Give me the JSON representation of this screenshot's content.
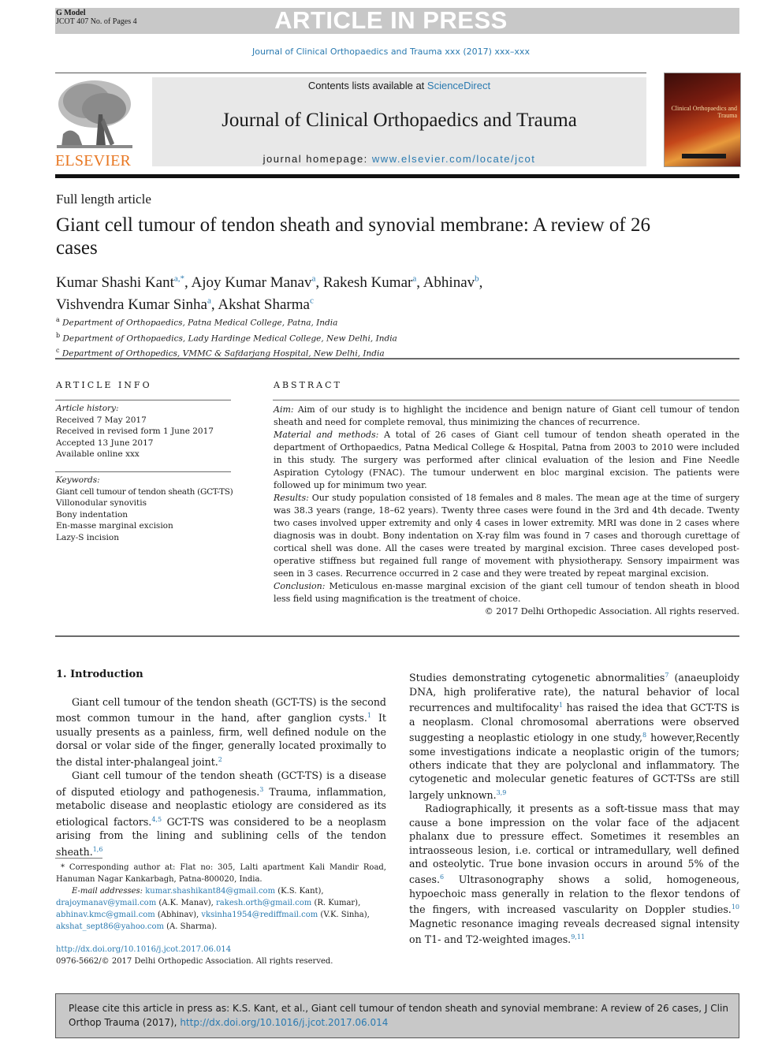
{
  "banner": {
    "g_model": "G Model",
    "jcot_line": "JCOT 407 No. of Pages 4",
    "status": "ARTICLE IN PRESS",
    "journal_ref": "Journal of Clinical Orthopaedics and Trauma xxx (2017) xxx–xxx"
  },
  "header": {
    "publisher": "ELSEVIER",
    "contents_prefix": "Contents lists available at ",
    "contents_link": "ScienceDirect",
    "journal_title": "Journal of Clinical Orthopaedics and Trauma",
    "homepage_prefix": "journal homepage: ",
    "homepage_link": "www.elsevier.com/locate/jcot",
    "cover_title": "Clinical Orthopaedics and Trauma"
  },
  "article": {
    "type": "Full length article",
    "title": "Giant cell tumour of tendon sheath and synovial membrane: A review of 26 cases",
    "authors": [
      {
        "name": "Kumar Shashi Kant",
        "aff": "a,*",
        "sep": ", "
      },
      {
        "name": "Ajoy Kumar Manav",
        "aff": "a",
        "sep": ", "
      },
      {
        "name": "Rakesh Kumar",
        "aff": "a",
        "sep": ", "
      },
      {
        "name": "Abhinav",
        "aff": "b",
        "sep": ","
      },
      {
        "name": "Vishvendra Kumar Sinha",
        "aff": "a",
        "sep": ", "
      },
      {
        "name": "Akshat Sharma",
        "aff": "c",
        "sep": ""
      }
    ],
    "affiliations": [
      {
        "letter": "a",
        "text": "Department of Orthopaedics, Patna Medical College, Patna, India"
      },
      {
        "letter": "b",
        "text": "Department of Orthopaedics, Lady Hardinge Medical College, New Delhi, India"
      },
      {
        "letter": "c",
        "text": "Department of Orthopedics, VMMC & Safdarjang Hospital, New Delhi, India"
      }
    ]
  },
  "article_info": {
    "heading": "ARTICLE INFO",
    "history_label": "Article history:",
    "history": [
      "Received 7 May 2017",
      "Received in revised form 1 June 2017",
      "Accepted 13 June 2017",
      "Available online xxx"
    ],
    "keywords_label": "Keywords:",
    "keywords": [
      "Giant cell tumour of tendon sheath (GCT-TS)",
      "Villonodular synovitis",
      "Bony indentation",
      "En-masse marginal excision",
      "Lazy-S incision"
    ]
  },
  "abstract": {
    "heading": "ABSTRACT",
    "sections": [
      {
        "label": "Aim:",
        "text": " Aim of our study is to highlight the incidence and benign nature of Giant cell tumour of tendon sheath and need for complete removal, thus minimizing the chances of recurrence."
      },
      {
        "label": "Material and methods:",
        "text": " A total of 26 cases of Giant cell tumour of tendon sheath operated in the department of Orthopaedics, Patna Medical College & Hospital, Patna from 2003 to 2010 were included in this study. The surgery was performed after clinical evaluation of the lesion and Fine Needle Aspiration Cytology (FNAC). The tumour underwent en bloc marginal excision. The patients were followed up for minimum two year."
      },
      {
        "label": "Results:",
        "text": " Our study population consisted of 18 females and 8 males. The mean age at the time of surgery was 38.3 years (range, 18–62 years). Twenty three cases were found in the 3rd and 4th decade. Twenty two cases involved upper extremity and only 4 cases in lower extremity. MRI was done in 2 cases where diagnosis was in doubt. Bony indentation on X-ray film was found in 7 cases and thorough curettage of cortical shell was done. All the cases were treated by marginal excision. Three cases developed post-operative stiffness but regained full range of movement with physiotherapy. Sensory impairment was seen in 3 cases. Recurrence occurred in 2 case and they were treated by repeat marginal excision."
      },
      {
        "label": "Conclusion:",
        "text": " Meticulous en-masse marginal excision of the giant cell tumour of tendon sheath in blood less field using magnification is the treatment of choice."
      }
    ],
    "copyright": "© 2017 Delhi Orthopedic Association. All rights reserved."
  },
  "body": {
    "section_heading": "1. Introduction",
    "left_paragraphs": [
      [
        {
          "t": "Giant cell tumour of the tendon sheath (GCT-TS) is the second most common tumour in the hand, after ganglion cysts."
        },
        {
          "ref": "1"
        },
        {
          "t": " It usually presents as a painless, firm, well defined nodule on the dorsal or volar side of the finger, generally located proximally to the distal inter-phalangeal joint."
        },
        {
          "ref": "2"
        }
      ],
      [
        {
          "t": "Giant cell tumour of the tendon sheath (GCT-TS) is a disease of disputed etiology and pathogenesis."
        },
        {
          "ref": "3"
        },
        {
          "t": " Trauma, inflammation, metabolic disease and neoplastic etiology are considered as its etiological factors."
        },
        {
          "ref": "4,5"
        },
        {
          "t": " GCT-TS was considered to be a neoplasm arising from the lining and sublining cells of the tendon sheath."
        },
        {
          "ref": "1,6"
        }
      ]
    ],
    "right_paragraphs": [
      [
        {
          "t": "Studies demonstrating cytogenetic abnormalities"
        },
        {
          "ref": "7"
        },
        {
          "t": " (anaeuploidy DNA, high proliferative rate), the natural behavior of local recurrences and multifocality"
        },
        {
          "ref": "1"
        },
        {
          "t": " has raised the idea that GCT-TS is a neoplasm. Clonal chromosomal aberrations were observed suggesting a neoplastic etiology in one study,"
        },
        {
          "ref": "8"
        },
        {
          "t": " however,Recently some investigations indicate a neoplastic origin of the tumors; others indicate that they are polyclonal and inflammatory. The cytogenetic and molecular genetic features of GCT-TSs are still largely unknown."
        },
        {
          "ref": "3,9"
        }
      ],
      [
        {
          "t": "Radiographically, it presents as a soft-tissue mass that may cause a bone impression on the volar face of the adjacent phalanx due to pressure effect. Sometimes it resembles an intraosseous lesion, i.e. cortical or intramedullary, well defined and osteolytic. True bone invasion occurs in around 5% of the cases."
        },
        {
          "ref": "6"
        },
        {
          "t": " Ultrasonography shows a solid, homogeneous, hypoechoic mass generally in relation to the flexor tendons of the fingers, with increased vascularity on Doppler studies."
        },
        {
          "ref": "10"
        },
        {
          "t": " Magnetic resonance imaging reveals decreased signal intensity on T1- and T2-weighted images."
        },
        {
          "ref": "9,11"
        }
      ]
    ]
  },
  "footnotes": {
    "corresponding": "* Corresponding author at: Flat no: 305, Lalti apartment Kali Mandir Road, Hanuman Nagar Kankarbagh, Patna-800020, India.",
    "email_label": "E-mail addresses:",
    "emails": [
      {
        "email": "kumar.shashikant84@gmail.com",
        "who": " (K.S. Kant),"
      },
      {
        "email": "drajoymanav@ymail.com",
        "who": " (A.K. Manav),"
      },
      {
        "email": "rakesh.orth@gmail.com",
        "who": " (R. Kumar),"
      },
      {
        "email": "abhinav.kmc@gmail.com",
        "who": " (Abhinav),"
      },
      {
        "email": "vksinha1954@rediffmail.com",
        "who": " (V.K. Sinha),"
      },
      {
        "email": "akshat_sept86@yahoo.com",
        "who": " (A. Sharma)."
      }
    ],
    "doi": "http://dx.doi.org/10.1016/j.jcot.2017.06.014",
    "issn": "0976-5662/© 2017 Delhi Orthopedic Association. All rights reserved."
  },
  "citation": {
    "text": "Please cite this article in press as: K.S. Kant, et al., Giant cell tumour of tendon sheath and synovial membrane: A review of 26 cases, J Clin Orthop Trauma (2017), ",
    "link": "http://dx.doi.org/10.1016/j.jcot.2017.06.014"
  }
}
